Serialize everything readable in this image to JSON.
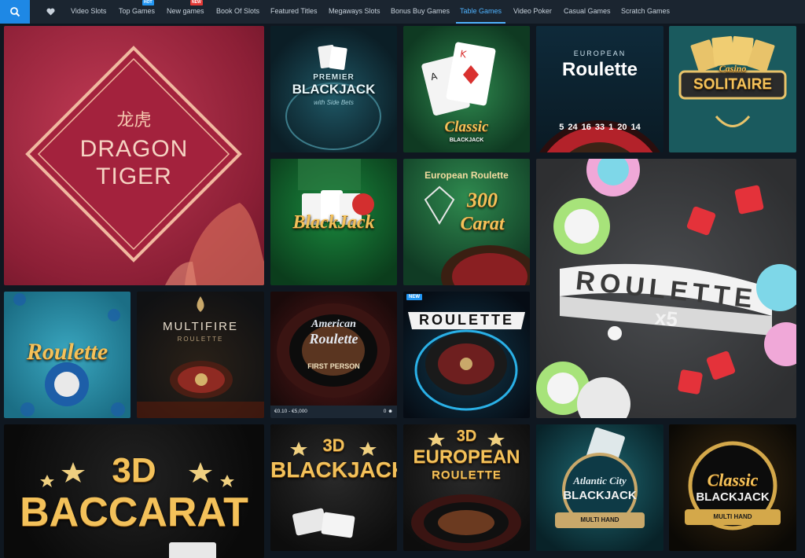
{
  "nav": {
    "items": [
      {
        "label": "Video Slots"
      },
      {
        "label": "Top Games",
        "badge": "HOT"
      },
      {
        "label": "New games",
        "badge": "NEW"
      },
      {
        "label": "Book Of Slots"
      },
      {
        "label": "Featured Titles"
      },
      {
        "label": "Megaways Slots"
      },
      {
        "label": "Bonus Buy Games"
      },
      {
        "label": "Table Games",
        "active": true
      },
      {
        "label": "Video Poker"
      },
      {
        "label": "Casual Games"
      },
      {
        "label": "Scratch Games"
      }
    ],
    "icons": {
      "search": "search-icon",
      "favorites": "heart-icon"
    },
    "colors": {
      "bar": "#1b2530",
      "accent": "#1e88e5",
      "active": "#4fb3ff",
      "hot": "#2196f3",
      "new": "#e53935"
    }
  },
  "games": {
    "dragon_tiger": {
      "line1": "龙虎",
      "line2": "DRAGON",
      "line3": "TIGER"
    },
    "premier_blackjack": {
      "line1": "PREMIER",
      "line2": "BLACKJACK",
      "line3": "with Side Bets"
    },
    "classic_blackjack": {
      "line1": "Classic",
      "line2": "BLACKJACK"
    },
    "european_roulette": {
      "line1": "EUROPEAN",
      "line2": "Roulette",
      "wheel_numbers": [
        "5",
        "24",
        "16",
        "33",
        "1",
        "20",
        "14"
      ]
    },
    "casino_solitaire": {
      "line1": "Casino",
      "line2": "SOLITAIRE"
    },
    "blackjack": {
      "line1": "BlackJack"
    },
    "european_roulette_300": {
      "line1": "European Roulette",
      "line2": "300",
      "line3": "Carat"
    },
    "roulette_x5": {
      "line1": "ROULETTE",
      "line2": "x5"
    },
    "roulette": {
      "line1": "Roulette"
    },
    "multifire_roulette": {
      "line1": "MULTIFIRE",
      "line2": "ROULETTE"
    },
    "american_roulette": {
      "line1": "American",
      "line2": "Roulette",
      "line3": "FIRST PERSON",
      "limits": "€0.10 - €5,000",
      "players": "0"
    },
    "roulette_new": {
      "badge": "NEW",
      "line1": "ROULETTE"
    },
    "baccarat_3d": {
      "line1": "3D",
      "line2": "BACCARAT"
    },
    "blackjack_3d": {
      "line1": "3D",
      "line2": "BLACKJACK"
    },
    "european_roulette_3d": {
      "line1": "3D",
      "line2": "EUROPEAN",
      "line3": "ROULETTE"
    },
    "atlantic_city": {
      "line1": "Atlantic City",
      "line2": "BLACKJACK",
      "line3": "MULTI HAND"
    },
    "classic_multihand": {
      "line1": "Classic",
      "line2": "BLACKJACK",
      "line3": "MULTI HAND"
    }
  }
}
